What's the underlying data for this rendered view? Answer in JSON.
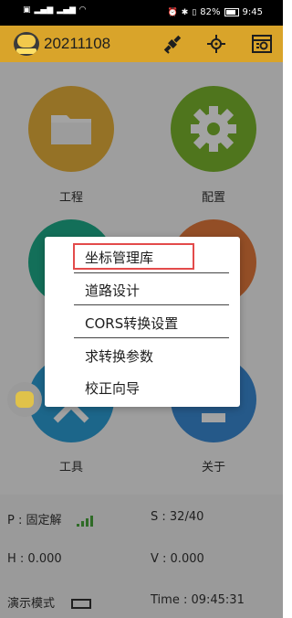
{
  "status_bar": {
    "left_icons": [
      "HD",
      "signal",
      "signal",
      "wifi"
    ],
    "right_icons": [
      "alarm",
      "bluetooth",
      "vibrate"
    ],
    "battery": "82%",
    "time": "9:45"
  },
  "header": {
    "project_name": "20211108",
    "icons": [
      "satellite-icon",
      "target-icon",
      "settings-window-icon"
    ]
  },
  "tiles": [
    {
      "label": "工程",
      "color": "#e9b23c",
      "icon": "folder-icon"
    },
    {
      "label": "配置",
      "color": "#7cb82e",
      "icon": "gear-icon"
    },
    {
      "label": "",
      "color": "#1fae8c",
      "icon": ""
    },
    {
      "label": "",
      "color": "#e77a3c",
      "icon": ""
    },
    {
      "label": "工具",
      "color": "#2da0d8",
      "icon": "tools-icon"
    },
    {
      "label": "关于",
      "color": "#3b8bd6",
      "icon": "info-icon"
    }
  ],
  "info": {
    "p": "P : 固定解",
    "s": "S : 32/40",
    "h": "H : 0.000",
    "v": "V : 0.000",
    "mode": "演示模式",
    "time": "Time :  09:45:31"
  },
  "menu": {
    "items": [
      "坐标管理库",
      "道路设计",
      "CORS转换设置",
      "求转换参数",
      "校正向导"
    ],
    "highlighted": "坐标管理库"
  },
  "colors": {
    "header_bg": "#d9a42a",
    "highlight_border": "#e34b4b",
    "signal_green": "#4aa83d"
  }
}
